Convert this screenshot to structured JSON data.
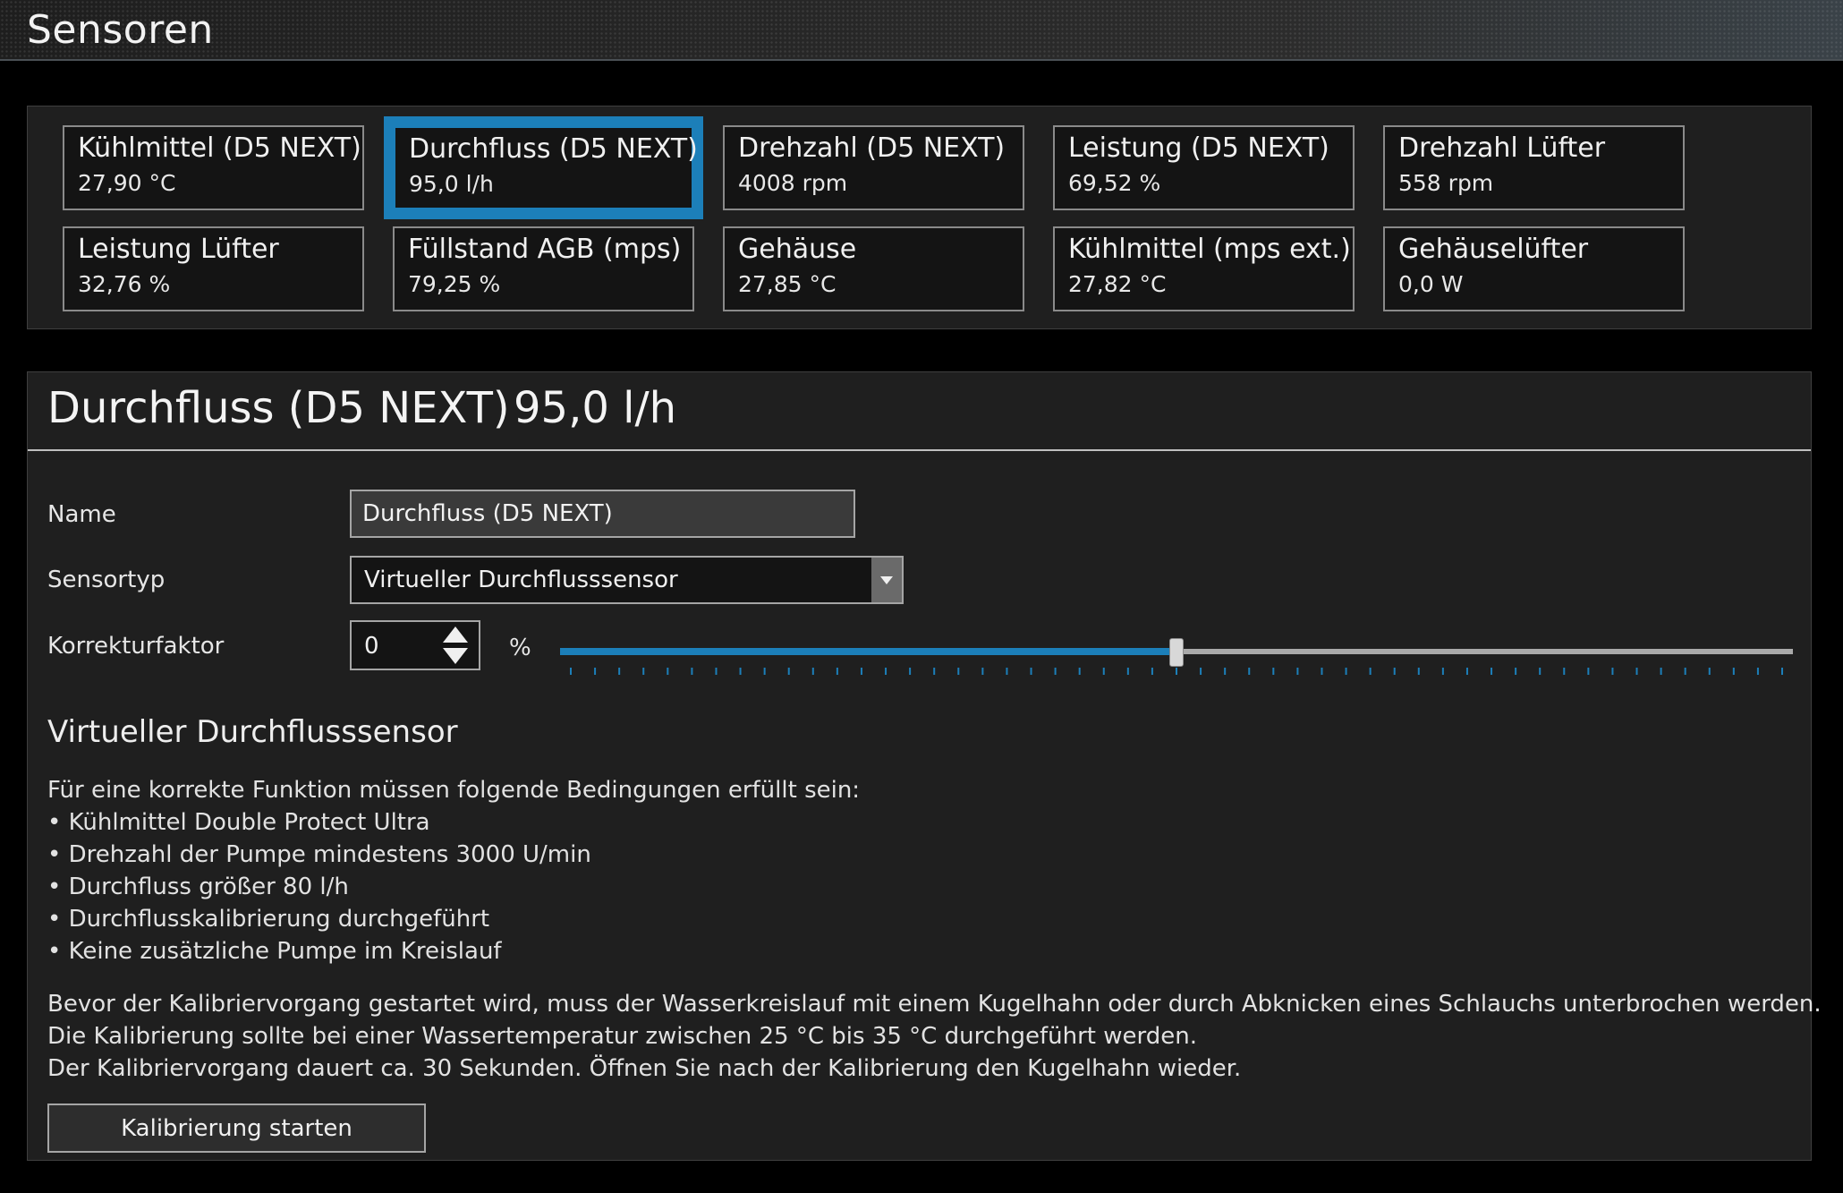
{
  "header": {
    "title": "Sensoren"
  },
  "sensors": [
    {
      "name": "Kühlmittel (D5 NEXT)",
      "value": "27,90 °C"
    },
    {
      "name": "Durchfluss (D5 NEXT)",
      "value": "95,0 l/h",
      "selected": true
    },
    {
      "name": "Drehzahl (D5 NEXT)",
      "value": "4008 rpm"
    },
    {
      "name": "Leistung (D5 NEXT)",
      "value": "69,52 %"
    },
    {
      "name": "Drehzahl Lüfter",
      "value": "558 rpm"
    },
    {
      "name": "Leistung Lüfter",
      "value": "32,76 %"
    },
    {
      "name": "Füllstand AGB (mps)",
      "value": "79,25 %"
    },
    {
      "name": "Gehäuse",
      "value": "27,85 °C"
    },
    {
      "name": "Kühlmittel (mps ext.)",
      "value": "27,82 °C"
    },
    {
      "name": "Gehäuselüfter",
      "value": "0,0 W"
    }
  ],
  "detail": {
    "title": "Durchfluss (D5 NEXT)",
    "value": "95,0 l/h",
    "name_label": "Name",
    "name_value": "Durchfluss (D5 NEXT)",
    "sensortype_label": "Sensortyp",
    "sensortype_value": "Virtueller Durchflusssensor",
    "correction_label": "Korrekturfaktor",
    "correction_value": "0",
    "correction_unit": "%",
    "slider_fraction": 0.5,
    "section_title": "Virtueller Durchflusssensor",
    "requirements_intro": "Für eine korrekte Funktion müssen folgende Bedingungen erfüllt sein:",
    "requirements": [
      "• Kühlmittel Double Protect Ultra",
      "• Drehzahl der Pumpe mindestens 3000 U/min",
      "• Durchfluss größer 80 l/h",
      "• Durchflusskalibrierung durchgeführt",
      "• Keine zusätzliche Pumpe im Kreislauf"
    ],
    "notes": [
      "Bevor der Kalibriervorgang gestartet wird, muss der Wasserkreislauf mit einem Kugelhahn oder durch Abknicken eines Schlauchs unterbrochen werden.",
      "Die Kalibrierung sollte bei einer Wassertemperatur zwischen 25 °C bis 35 °C durchgeführt werden.",
      "Der Kalibriervorgang dauert ca. 30 Sekunden. Öffnen Sie nach der Kalibrierung den Kugelhahn wieder."
    ],
    "button_label": "Kalibrierung starten"
  },
  "colors": {
    "accent": "#1c7fb9",
    "background": "#000000",
    "panel": "#1f1f1f",
    "card": "#141414",
    "border": "#8a8a8a"
  }
}
